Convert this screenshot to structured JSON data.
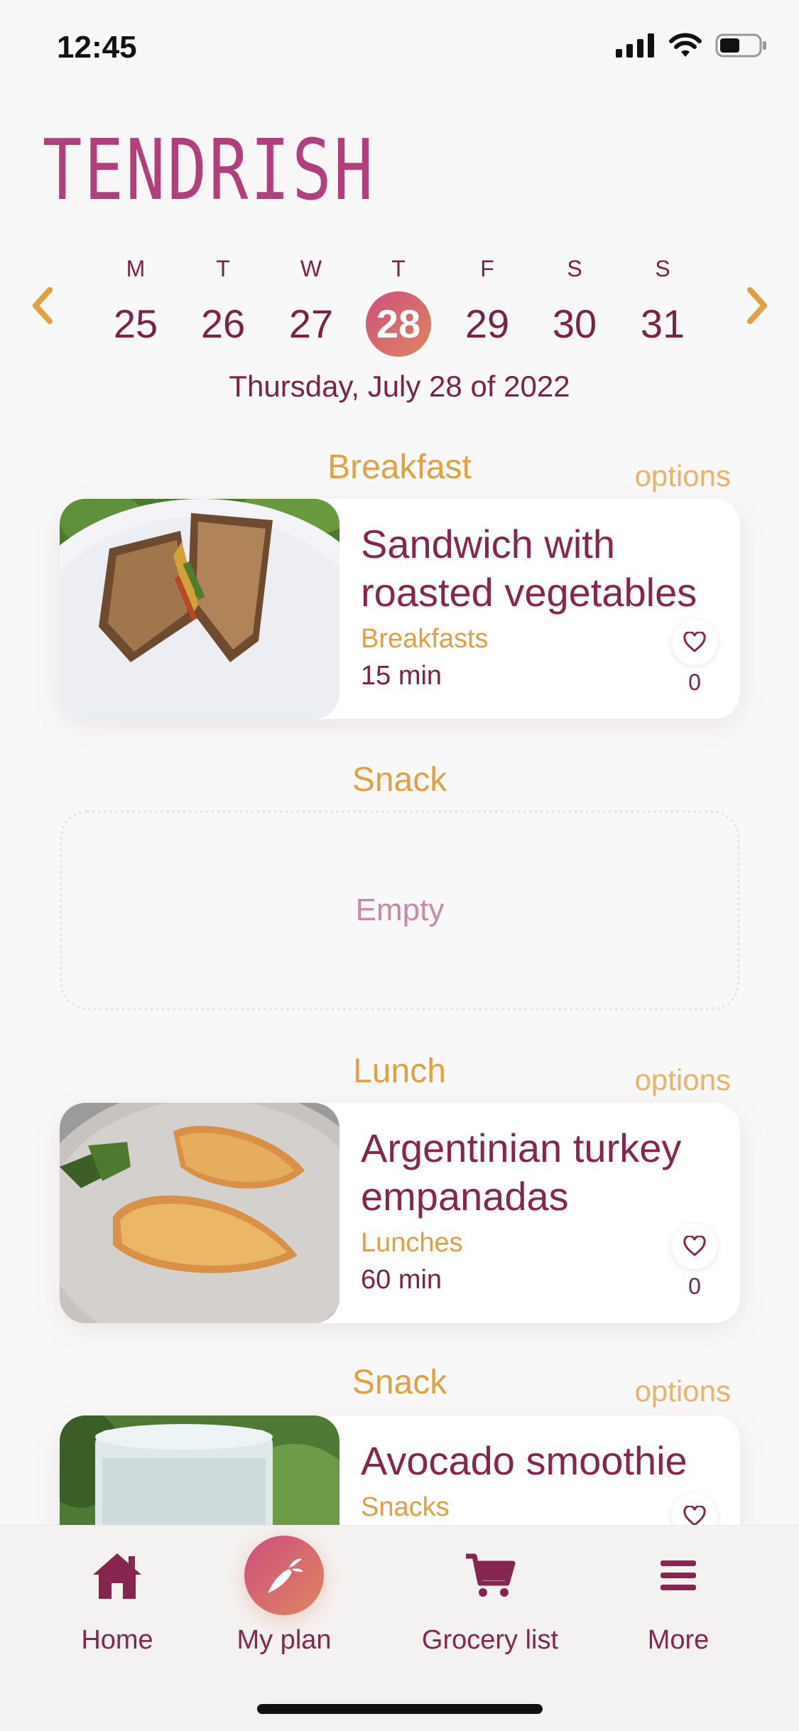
{
  "status": {
    "time": "12:45"
  },
  "header": {
    "logo_text": "TENDRISH"
  },
  "calendar": {
    "days": [
      {
        "letter": "M",
        "num": "25"
      },
      {
        "letter": "T",
        "num": "26"
      },
      {
        "letter": "W",
        "num": "27"
      },
      {
        "letter": "T",
        "num": "28",
        "selected": true
      },
      {
        "letter": "F",
        "num": "29"
      },
      {
        "letter": "S",
        "num": "30"
      },
      {
        "letter": "S",
        "num": "31"
      }
    ],
    "selected_date": "Thursday, July 28 of 2022"
  },
  "meals": {
    "breakfast": {
      "title": "Breakfast",
      "options_label": "options",
      "recipe": {
        "name": "Sandwich with roasted vegetables",
        "category": "Breakfasts",
        "time": "15 min",
        "likes": "0"
      }
    },
    "snack1": {
      "title": "Snack",
      "empty_label": "Empty"
    },
    "lunch": {
      "title": "Lunch",
      "options_label": "options",
      "recipe": {
        "name": "Argentinian turkey empanadas",
        "category": "Lunches",
        "time": "60 min",
        "likes": "0"
      }
    },
    "snack2": {
      "title": "Snack",
      "options_label": "options",
      "recipe": {
        "name": "Avocado smoothie",
        "category": "Snacks"
      }
    }
  },
  "tabbar": {
    "items": [
      {
        "label": "Home",
        "icon": "home-icon"
      },
      {
        "label": "My plan",
        "icon": "carrot-icon"
      },
      {
        "label": "Grocery list",
        "icon": "cart-icon"
      },
      {
        "label": "More",
        "icon": "menu-icon"
      }
    ]
  },
  "colors": {
    "primary": "#86264f",
    "accent": "#e0a144",
    "gradient_start": "#cc4f7d",
    "gradient_end": "#e08560"
  }
}
